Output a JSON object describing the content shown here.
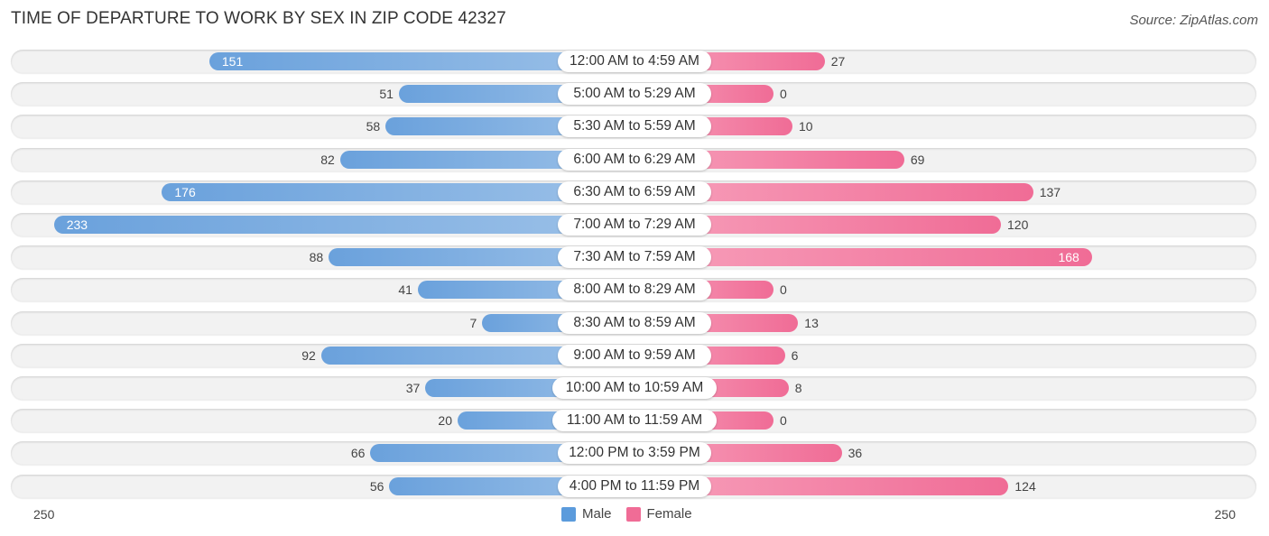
{
  "chart_data": {
    "type": "bar",
    "orientation": "horizontal-diverging",
    "title": "TIME OF DEPARTURE TO WORK BY SEX IN ZIP CODE 42327",
    "source": "Source: ZipAtlas.com",
    "categories": [
      "12:00 AM to 4:59 AM",
      "5:00 AM to 5:29 AM",
      "5:30 AM to 5:59 AM",
      "6:00 AM to 6:29 AM",
      "6:30 AM to 6:59 AM",
      "7:00 AM to 7:29 AM",
      "7:30 AM to 7:59 AM",
      "8:00 AM to 8:29 AM",
      "8:30 AM to 8:59 AM",
      "9:00 AM to 9:59 AM",
      "10:00 AM to 10:59 AM",
      "11:00 AM to 11:59 AM",
      "12:00 PM to 3:59 PM",
      "4:00 PM to 11:59 PM"
    ],
    "series": [
      {
        "name": "Male",
        "color": "#5b9bdc",
        "values": [
          151,
          51,
          58,
          82,
          176,
          233,
          88,
          41,
          7,
          92,
          37,
          20,
          66,
          56
        ]
      },
      {
        "name": "Female",
        "color": "#f06c96",
        "values": [
          27,
          0,
          10,
          69,
          137,
          120,
          168,
          0,
          13,
          6,
          8,
          0,
          36,
          124
        ]
      }
    ],
    "axis_min_label": "250",
    "axis_max_label": "250",
    "xlim": [
      -250,
      250
    ],
    "legend": {
      "position": "bottom-center",
      "items": [
        "Male",
        "Female"
      ]
    }
  }
}
